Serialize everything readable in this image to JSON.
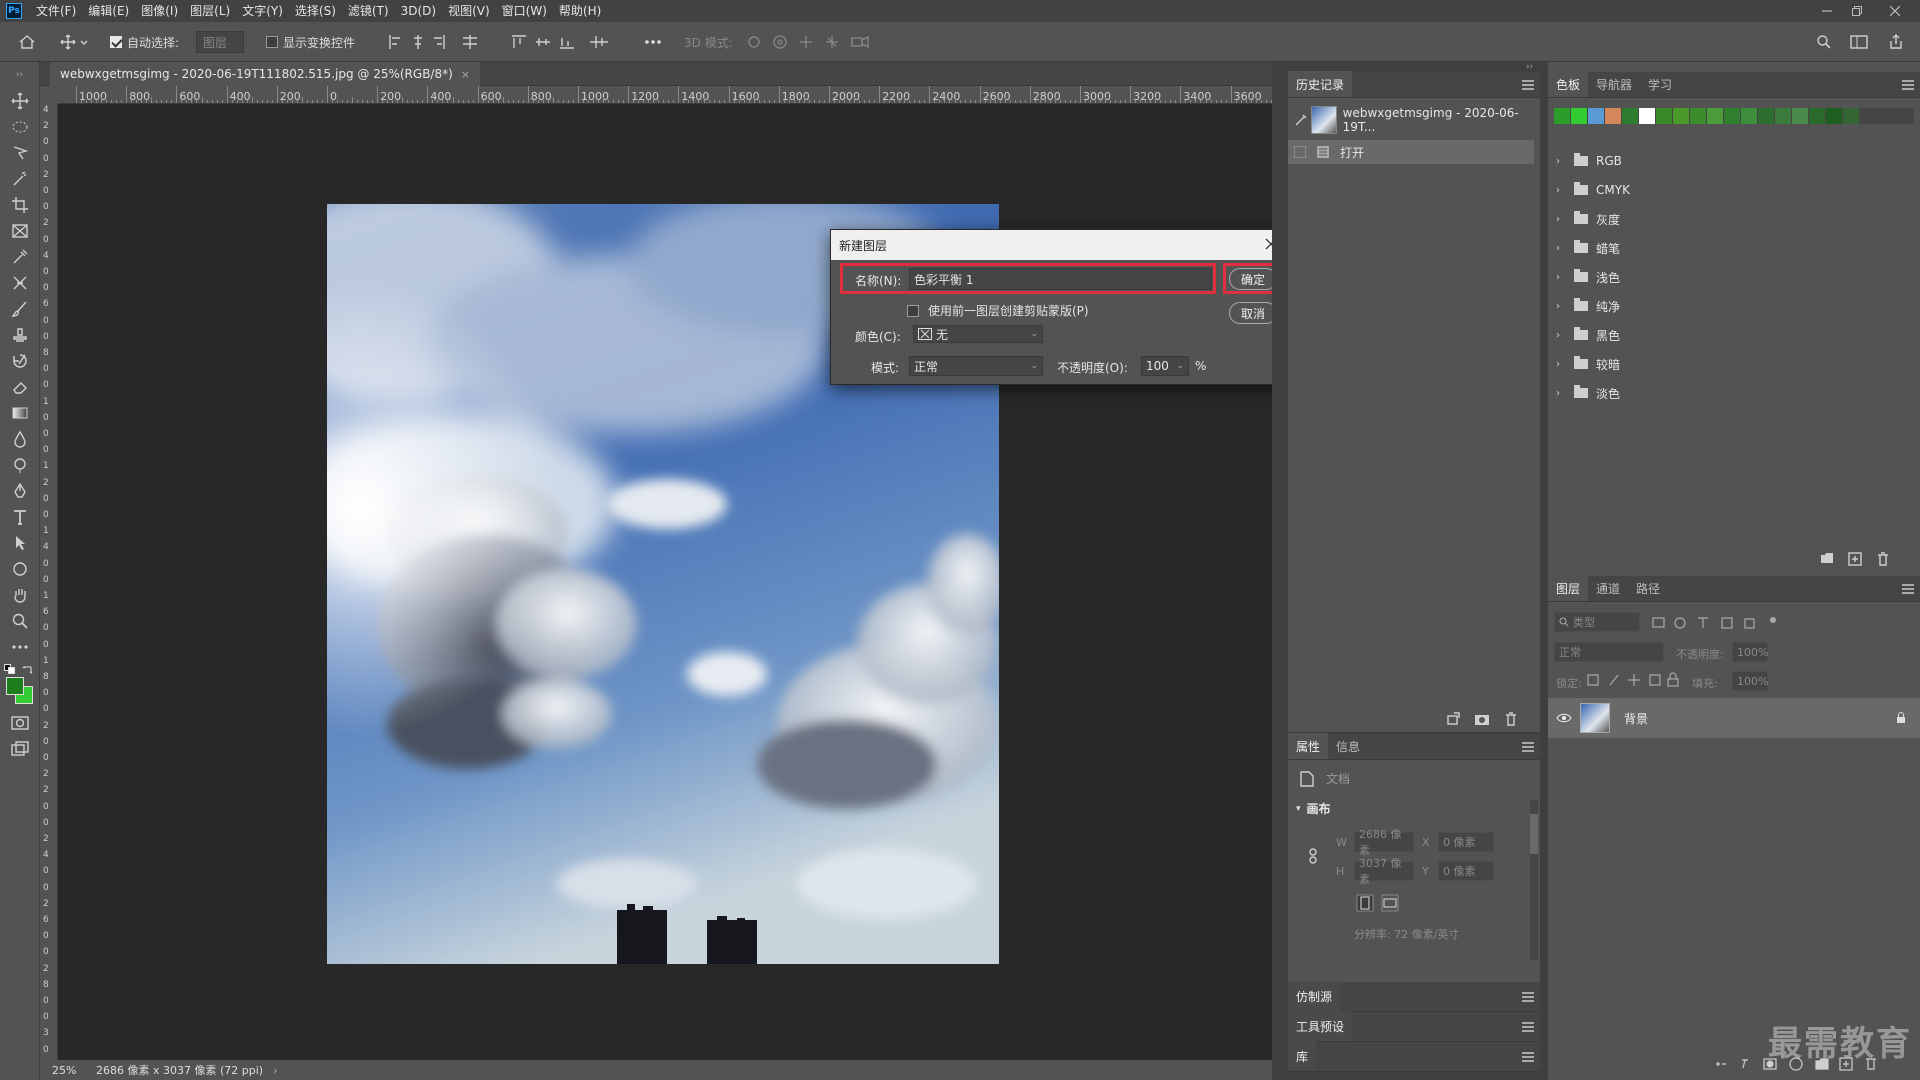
{
  "app": {
    "logo": "Ps"
  },
  "menu": [
    "文件(F)",
    "编辑(E)",
    "图像(I)",
    "图层(L)",
    "文字(Y)",
    "选择(S)",
    "滤镜(T)",
    "3D(D)",
    "视图(V)",
    "窗口(W)",
    "帮助(H)"
  ],
  "options": {
    "auto_select_label": "自动选择:",
    "auto_select_checked": true,
    "target": "图层",
    "show_transform_label": "显示变换控件",
    "mode_3d_label": "3D 模式:"
  },
  "document": {
    "tab_title": "webwxgetmsgimg - 2020-06-19T111802.515.jpg @ 25%(RGB/8*)",
    "ruler_h": [
      "1000",
      "800",
      "600",
      "400",
      "200",
      "0",
      "200",
      "400",
      "600",
      "800",
      "1000",
      "1200",
      "1400",
      "1600",
      "1800",
      "2000",
      "2200",
      "2400",
      "2600",
      "2800",
      "3000",
      "3200",
      "3400",
      "3600"
    ],
    "ruler_v": [
      "4",
      "2",
      "0",
      "0",
      "2",
      "0",
      "0",
      "2",
      "0",
      "4",
      "0",
      "0",
      "6",
      "0",
      "0",
      "8",
      "0",
      "0",
      "1",
      "0",
      "0",
      "0",
      "1",
      "2",
      "0",
      "0",
      "1",
      "4",
      "0",
      "0",
      "1",
      "6",
      "0",
      "0",
      "1",
      "8",
      "0",
      "0",
      "2",
      "0",
      "0",
      "2",
      "2",
      "0",
      "0",
      "2",
      "4",
      "0",
      "0",
      "2",
      "6",
      "0",
      "0",
      "2",
      "8",
      "0",
      "0",
      "3",
      "0"
    ]
  },
  "status": {
    "zoom": "25%",
    "info": "2686 像素 x 3037 像素 (72 ppi)"
  },
  "history": {
    "tabs": [
      "历史记录"
    ],
    "snapshot": "webwxgetmsgimg - 2020-06-19T...",
    "items": [
      "打开"
    ]
  },
  "swatches": {
    "tabs": [
      "色板",
      "导航器",
      "学习"
    ],
    "colors": [
      "#2a9d2a",
      "#33cc33",
      "#5b9bd5",
      "#d4875a",
      "#2e7d2e",
      "#ffffff",
      "#3a8a2a",
      "#4a9a2a",
      "#3c8c2c",
      "#4b9b3b",
      "#2f7f2f",
      "#3e8e3e",
      "#2d6d2d",
      "#3b7b3b",
      "#4a8a4a",
      "#2a6a2a",
      "#1e5e1e",
      "#336633"
    ],
    "groups": [
      "RGB",
      "CMYK",
      "灰度",
      "蜡笔",
      "浅色",
      "纯净",
      "黑色",
      "较暗",
      "淡色"
    ]
  },
  "properties": {
    "tabs": [
      "属性",
      "信息"
    ],
    "doc_label": "文档",
    "section": "画布",
    "w_label": "W",
    "w_value": "2686 像素",
    "h_label": "H",
    "h_value": "3037 像素",
    "x_label": "X",
    "x_value": "0 像素",
    "y_label": "Y",
    "y_value": "0 像素",
    "resolution": "分辨率: 72 像素/英寸"
  },
  "collapsed_panels": [
    "仿制源",
    "工具预设",
    "库"
  ],
  "layers": {
    "tabs": [
      "图层",
      "通道",
      "路径"
    ],
    "filter_label": "类型",
    "blend_mode": "正常",
    "opacity_label": "不透明度:",
    "opacity_value": "100%",
    "lock_label": "锁定:",
    "fill_label": "填充:",
    "fill_value": "100%",
    "items": [
      {
        "name": "背景",
        "locked": true
      }
    ]
  },
  "dialog": {
    "title": "新建图层",
    "name_label": "名称(N):",
    "name_value": "色彩平衡 1",
    "clip_label": "使用前一图层创建剪贴蒙版(P)",
    "color_label": "颜色(C):",
    "color_value": "无",
    "mode_label": "模式:",
    "mode_value": "正常",
    "opacity_label": "不透明度(O):",
    "opacity_value": "100",
    "opacity_unit": "%",
    "ok_label": "确定",
    "cancel_label": "取消"
  },
  "watermark": "最需教育",
  "colors": {
    "foreground": "#1e7e1e",
    "background": "#33cc33",
    "highlight": "#e03040"
  }
}
